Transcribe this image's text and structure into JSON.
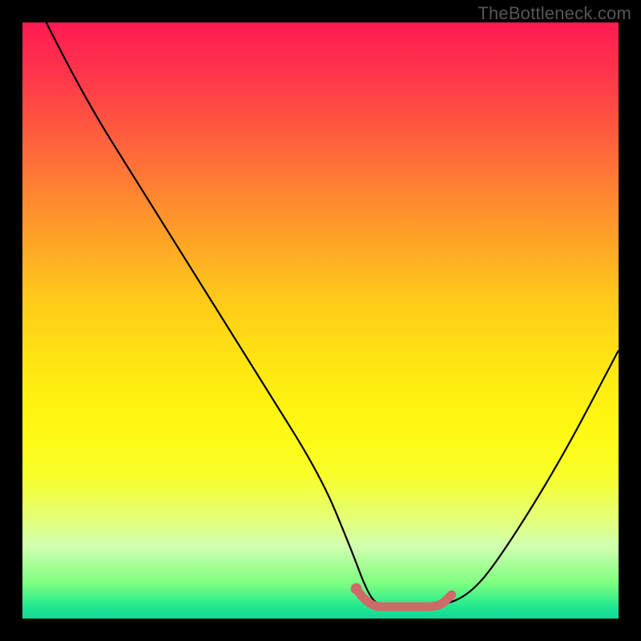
{
  "watermark": "TheBottleneck.com",
  "chart_data": {
    "type": "line",
    "title": "",
    "xlabel": "",
    "ylabel": "",
    "xlim": [
      0,
      100
    ],
    "ylim": [
      0,
      100
    ],
    "series": [
      {
        "name": "bottleneck-curve",
        "x": [
          4,
          10,
          20,
          30,
          40,
          50,
          55,
          58,
          60,
          65,
          70,
          75,
          80,
          90,
          100
        ],
        "y": [
          100,
          88,
          72,
          56,
          40,
          24,
          12,
          4,
          2,
          2,
          2,
          4,
          10,
          26,
          45
        ]
      },
      {
        "name": "highlight-segment",
        "x": [
          56,
          58,
          62,
          66,
          70,
          72
        ],
        "y": [
          5,
          2,
          2,
          2,
          2,
          4
        ]
      }
    ],
    "colors": {
      "curve": "#000000",
      "highlight": "#d06a68",
      "gradient_top": "#ff1a52",
      "gradient_bottom": "#10d898"
    }
  }
}
